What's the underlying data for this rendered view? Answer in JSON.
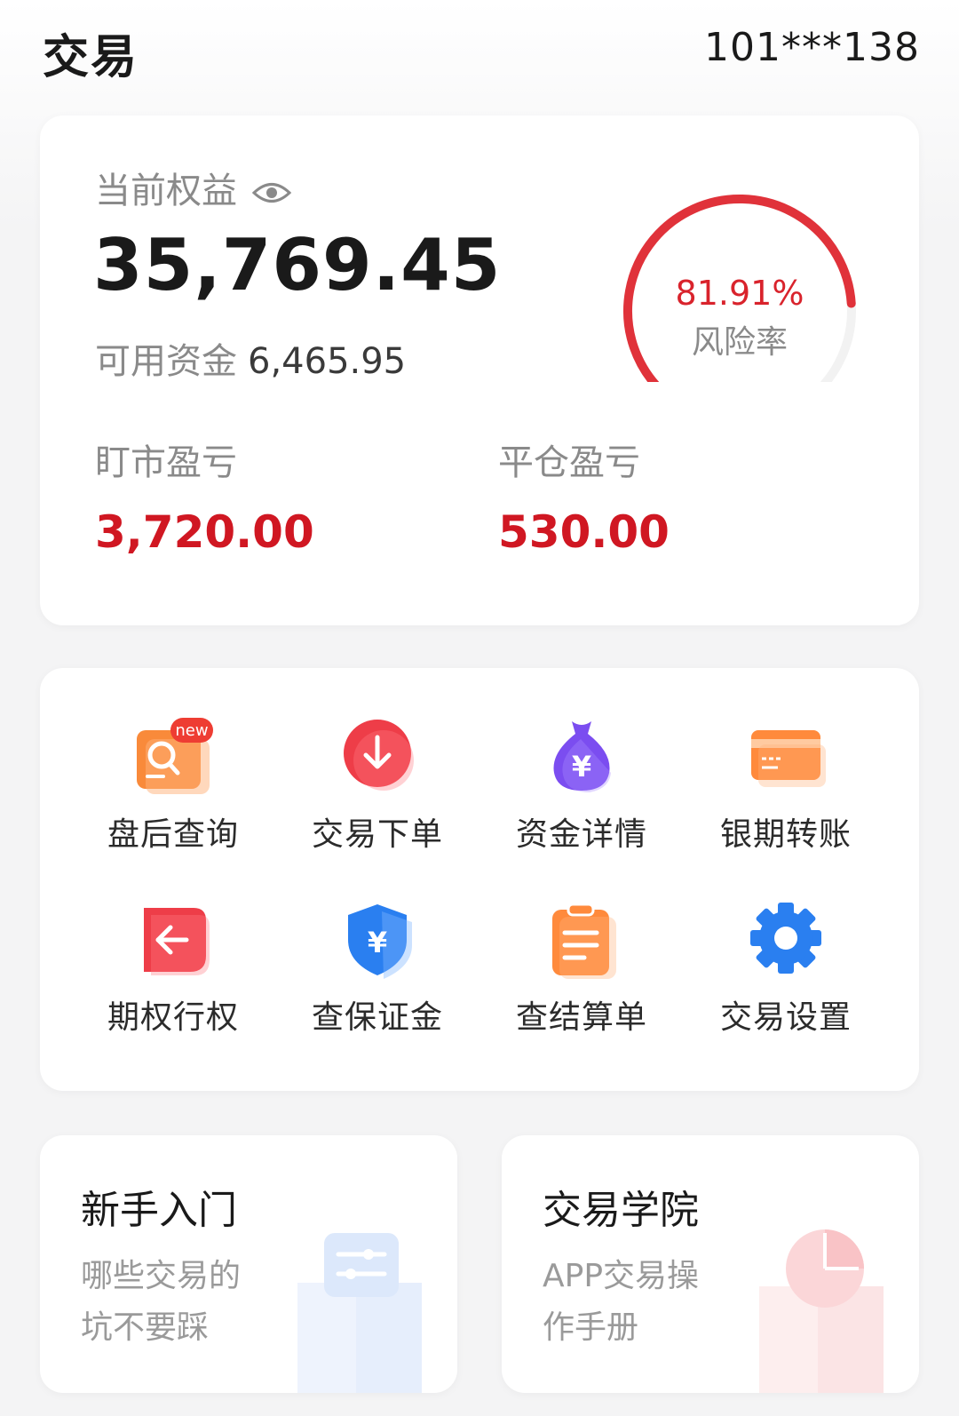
{
  "header": {
    "title": "交易",
    "account": "101***138"
  },
  "equity": {
    "label": "当前权益",
    "value": "35,769.45",
    "available_label": "可用资金",
    "available_value": "6,465.95",
    "risk_rate": "81.91%",
    "risk_label": "风险率",
    "risk_fraction": 0.8191,
    "mark_to_market_label": "盯市盈亏",
    "mark_to_market_value": "3,720.00",
    "close_pl_label": "平仓盈亏",
    "close_pl_value": "530.00"
  },
  "menu": {
    "items": [
      {
        "label": "盘后查询",
        "icon": "search-doc-icon",
        "badge": "new"
      },
      {
        "label": "交易下单",
        "icon": "download-arrow-icon"
      },
      {
        "label": "资金详情",
        "icon": "money-bag-icon"
      },
      {
        "label": "银期转账",
        "icon": "bank-card-icon"
      },
      {
        "label": "期权行权",
        "icon": "back-arrow-icon"
      },
      {
        "label": "查保证金",
        "icon": "shield-yen-icon"
      },
      {
        "label": "查结算单",
        "icon": "clipboard-icon"
      },
      {
        "label": "交易设置",
        "icon": "gear-icon"
      }
    ]
  },
  "promos": [
    {
      "title": "新手入门",
      "subtitle_line1": "哪些交易的",
      "subtitle_line2": "坑不要踩",
      "icon": "sliders-icon"
    },
    {
      "title": "交易学院",
      "subtitle_line1": "APP交易操",
      "subtitle_line2": "作手册",
      "icon": "pie-chart-icon"
    }
  ],
  "colors": {
    "accent_red": "#d01722",
    "gauge_red": "#e0323a"
  }
}
